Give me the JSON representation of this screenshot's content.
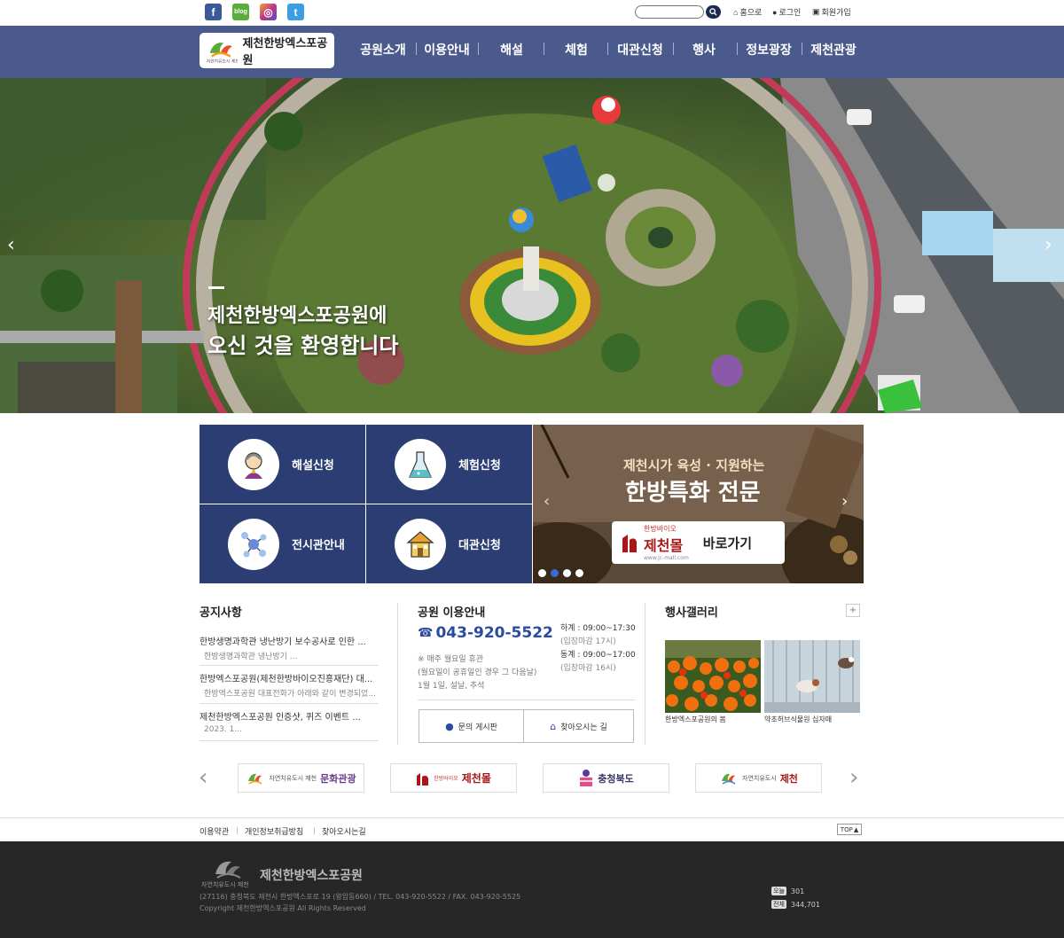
{
  "header": {
    "sns": [
      {
        "name": "facebook",
        "color": "#3b5998",
        "glyph": "f"
      },
      {
        "name": "blog",
        "color": "#5aad3a",
        "glyph": "blog"
      },
      {
        "name": "instagram",
        "color": "#c13584",
        "glyph": "◎"
      },
      {
        "name": "twitter",
        "color": "#3a9ee0",
        "glyph": "t"
      }
    ],
    "search": {
      "placeholder": ""
    },
    "utils": {
      "home": "홈으로",
      "login": "로그인",
      "join": "회원가입"
    }
  },
  "logo": {
    "name": "제천한방엑스포공원",
    "sub": "자연치유도시 제천"
  },
  "nav": [
    "공원소개",
    "이용안내",
    "해설",
    "체험",
    "대관신청",
    "행사",
    "정보광장",
    "제천관광"
  ],
  "hero": {
    "line1": "제천한방엑스포공원에",
    "line2": "오신 것을 환영합니다"
  },
  "quick": [
    {
      "label": "해설신청",
      "icon": "guide-icon"
    },
    {
      "label": "체험신청",
      "icon": "flask-icon"
    },
    {
      "label": "전시관안내",
      "icon": "molecule-icon"
    },
    {
      "label": "대관신청",
      "icon": "house-icon"
    }
  ],
  "banner": {
    "top": "제천시가 육성 · 지원하는",
    "main": "한방특화 전문",
    "button": "바로가기",
    "brand": "제천몰",
    "brand_sub": "한방바이오",
    "url": "www.jc-mall.com"
  },
  "notice": {
    "title": "공지사항",
    "items": [
      {
        "title": "한방생명과학관 냉난방기 보수공사로 인한 ...",
        "sub": "한방생명과학관 냉난방기 ..."
      },
      {
        "title": "한방엑스포공원(제천한방바이오진흥재단) 대...",
        "sub": "한방엑스포공원 대표전화가 아래와 같이 변경되었..."
      },
      {
        "title": "제천한방엑스포공원 인증샷, 퀴즈 이벤트 ...",
        "sub": "2023. 1..."
      }
    ]
  },
  "info": {
    "title": "공원 이용안내",
    "phone": "043-920-5522",
    "closed": [
      "※ 매주 월요일 휴관",
      "(월요일이 공휴일인 경우 그 다음날)",
      "1월 1일, 설날, 추석"
    ],
    "summer": "하계 : 09:00~17:30",
    "summer_note": "(입장마감 17시)",
    "winter": "동계 : 09:00~17:00",
    "winter_note": "(입장마감 16시)",
    "btn_qna": "문의 게시판",
    "btn_map": "찾아오시는 길"
  },
  "gallery": {
    "title": "행사갤러리",
    "more": "+",
    "items": [
      {
        "caption": "한방엑스포공원의 봄"
      },
      {
        "caption": "약초허브식물원 십자매"
      }
    ]
  },
  "partners": [
    {
      "label": "문화관광",
      "pre": "자연치유도시 제천"
    },
    {
      "label": "제천몰",
      "pre": "한방바이오"
    },
    {
      "label": "충청북도",
      "pre": ""
    },
    {
      "label": "제천",
      "pre": "자연치유도시"
    }
  ],
  "footer_links": [
    "이용약관",
    "개인정보취급방침",
    "찾아오시는길"
  ],
  "top_button": "TOP",
  "footer": {
    "name": "제천한방엑스포공원",
    "address": "(27116) 충청북도 제천시 한방엑스포로 19 (왕암동660) / TEL. 043-920-5522 / FAX. 043-920-5525",
    "copyright": "Copyright 제천한방엑스포공원 All Rights Reserved",
    "today_label": "오늘",
    "today": "301",
    "total_label": "전체",
    "total": "344,701"
  }
}
